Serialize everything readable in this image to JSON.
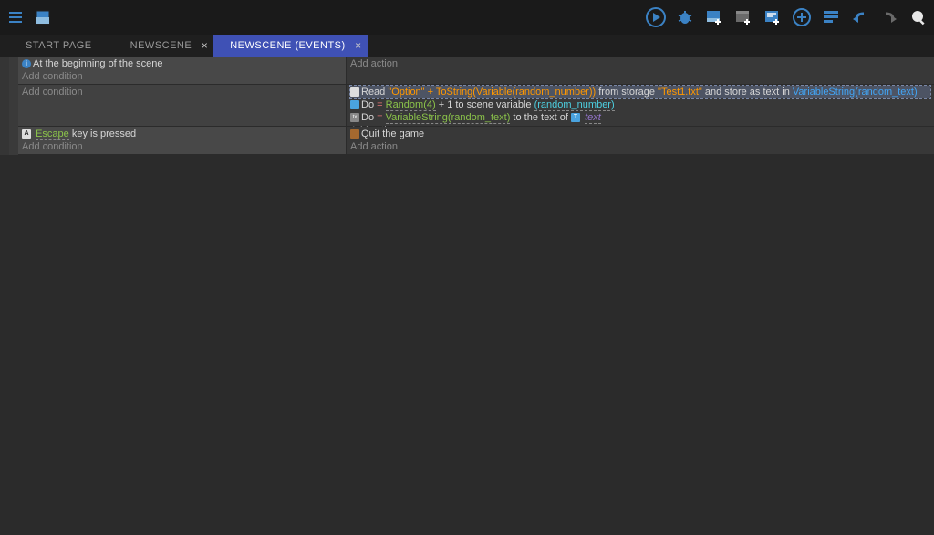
{
  "tabs": {
    "start_page": "START PAGE",
    "newscene": "NEWSCENE",
    "newscene_events": "NEWSCENE (EVENTS)"
  },
  "labels": {
    "add_condition": "Add condition",
    "add_action": "Add action"
  },
  "conditions": {
    "event1": "At the beginning of the scene",
    "event3_key": "Escape",
    "event3_rest": " key is pressed"
  },
  "actions": {
    "read_prefix": "Read ",
    "read_expr": "\"Option\" + ToString(Variable(random_number))",
    "read_mid": " from storage ",
    "read_storage": "\"Test1.txt\"",
    "read_store": " and store as text in ",
    "read_target": "VariableString(random_text)",
    "do1_prefix": "Do ",
    "do1_eq": "=",
    "do1_expr": "Random(4)",
    "do1_plus": " + 1",
    "do1_mid": " to scene variable ",
    "do1_var": "(random_number)",
    "do2_prefix": "Do ",
    "do2_eq": "=",
    "do2_expr": "VariableString(random_text)",
    "do2_mid": " to the text of ",
    "do2_obj": "text",
    "quit": "Quit the game"
  }
}
